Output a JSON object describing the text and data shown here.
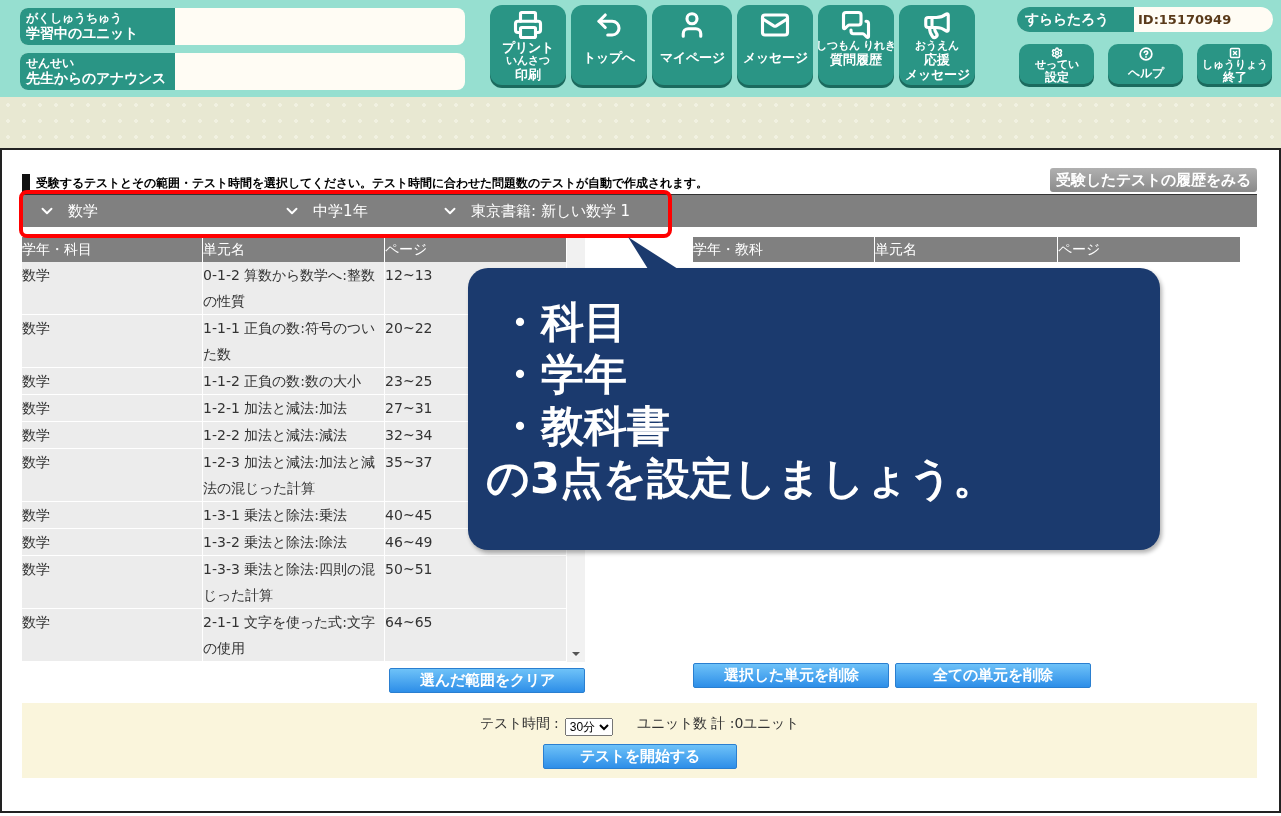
{
  "header": {
    "unit_labels": [
      {
        "ruby": "がくしゅうちゅう",
        "text": "学習中のユニット"
      },
      {
        "ruby": "せんせい",
        "text": "先生からのアナウンス"
      }
    ],
    "nav_buttons": [
      {
        "kind": "print",
        "top": "プリント",
        "ruby": "いんさつ",
        "label": "印刷"
      },
      {
        "kind": "home",
        "label": "トップへ"
      },
      {
        "kind": "mypage",
        "label": "マイページ"
      },
      {
        "kind": "message",
        "label": "メッセージ"
      },
      {
        "kind": "history",
        "ruby": "しつもん りれき",
        "label": "質問履歴"
      },
      {
        "kind": "cheer",
        "ruby": "おうえん",
        "label": "応援",
        "bottom": "メッセージ"
      }
    ],
    "user": {
      "name": "すららたろう",
      "id": "ID:15170949"
    },
    "util_buttons": [
      {
        "kind": "settings",
        "ruby": "せってい",
        "label": "設定"
      },
      {
        "kind": "help",
        "label": "ヘルプ"
      },
      {
        "kind": "exit",
        "ruby": "しゅうりょう",
        "label": "終了"
      }
    ]
  },
  "main": {
    "instruction": "受験するテストとその範囲・テスト時間を選択してください。テスト時間に合わせた問題数のテストが自動で作成されます。",
    "history_button": "受験したテストの履歴をみる",
    "filters": [
      {
        "label": "数学"
      },
      {
        "label": "中学1年"
      },
      {
        "label": "東京書籍: 新しい数学 1"
      }
    ],
    "left_table": {
      "columns": [
        "学年・科目",
        "単元名",
        "ページ"
      ],
      "rows": [
        [
          "数学",
          "0-1-2 算数から数学へ:整数の性質",
          "12~13"
        ],
        [
          "数学",
          "1-1-1 正負の数:符号のついた数",
          "20~22"
        ],
        [
          "数学",
          "1-1-2 正負の数:数の大小",
          "23~25"
        ],
        [
          "数学",
          "1-2-1 加法と減法:加法",
          "27~31"
        ],
        [
          "数学",
          "1-2-2 加法と減法:減法",
          "32~34"
        ],
        [
          "数学",
          "1-2-3 加法と減法:加法と減法の混じった計算",
          "35~37"
        ],
        [
          "数学",
          "1-3-1 乗法と除法:乗法",
          "40~45"
        ],
        [
          "数学",
          "1-3-2 乗法と除法:除法",
          "46~49"
        ],
        [
          "数学",
          "1-3-3 乗法と除法:四則の混じった計算",
          "50~51"
        ],
        [
          "数学",
          "2-1-1 文字を使った式:文字の使用",
          "64~65"
        ]
      ]
    },
    "clear_button": "選んだ範囲をクリア",
    "right_table": {
      "columns": [
        "学年・教科",
        "単元名",
        "ページ"
      ]
    },
    "right_buttons": [
      "選択した単元を削除",
      "全ての単元を削除"
    ],
    "test_time_label": "テスト時間 :",
    "test_time_value": "30分",
    "unit_count": "ユニット数 計 :0ユニット",
    "start_button": "テストを開始する"
  },
  "callout": {
    "lines": [
      "・科目",
      "・学年",
      "・教科書",
      "の3点を設定しましょう。"
    ]
  }
}
